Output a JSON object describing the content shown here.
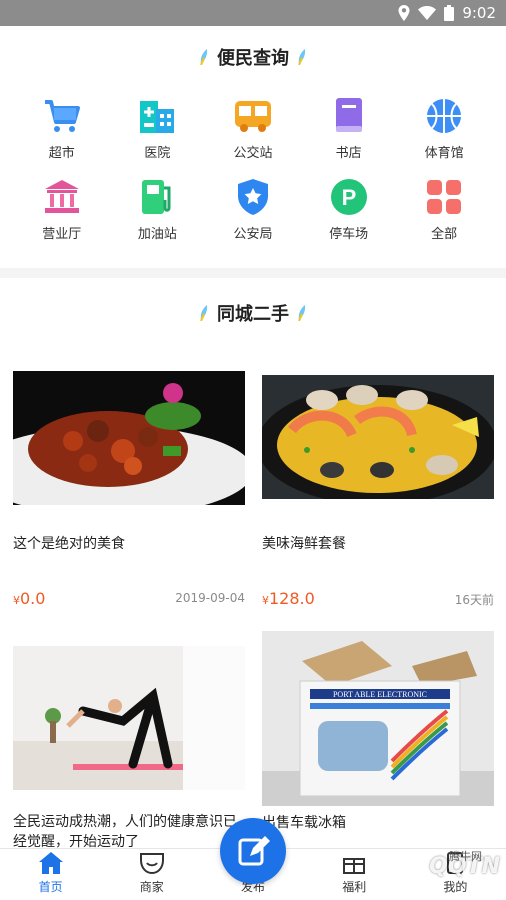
{
  "status_bar": {
    "time": "9:02"
  },
  "convenience": {
    "title": "便民查询",
    "items": [
      {
        "label": "超市",
        "icon": "cart-icon",
        "color": "#3a8ef0"
      },
      {
        "label": "医院",
        "icon": "hospital-icon",
        "color": "#1bc2d8"
      },
      {
        "label": "公交站",
        "icon": "bus-icon",
        "color": "#f5a623"
      },
      {
        "label": "书店",
        "icon": "book-icon",
        "color": "#8f6be8"
      },
      {
        "label": "体育馆",
        "icon": "basketball-icon",
        "color": "#3d8ef5"
      },
      {
        "label": "营业厅",
        "icon": "bank-icon",
        "color": "#f06aa3"
      },
      {
        "label": "加油站",
        "icon": "gas-station-icon",
        "color": "#2fcf7c"
      },
      {
        "label": "公安局",
        "icon": "police-badge-icon",
        "color": "#2e86f0"
      },
      {
        "label": "停车场",
        "icon": "parking-icon",
        "color": "#22c47a"
      },
      {
        "label": "全部",
        "icon": "grid-icon",
        "color": "#f5706a"
      }
    ]
  },
  "secondhand": {
    "title": "同城二手",
    "products": [
      {
        "title": "这个是绝对的美食",
        "currency": "¥",
        "price": "0.0",
        "date": "2019-09-04"
      },
      {
        "title": "美味海鲜套餐",
        "currency": "¥",
        "price": "128.0",
        "date": "16天前"
      },
      {
        "title": "全民运动成热潮，人们的健康意识已经觉醒，开始运动了",
        "currency": "",
        "price": "",
        "date": ""
      },
      {
        "title": "出售车载冰箱",
        "currency": "",
        "price": "",
        "date": "",
        "box_text": "PORT ABLE ELECTRONIC"
      }
    ]
  },
  "tabbar": {
    "items": [
      {
        "label": "首页",
        "icon": "home-icon"
      },
      {
        "label": "商家",
        "icon": "shop-icon"
      },
      {
        "label": "发布",
        "icon": "edit-icon"
      },
      {
        "label": "福利",
        "icon": "gift-icon"
      },
      {
        "label": "我的",
        "icon": "user-icon"
      }
    ]
  },
  "watermark": {
    "text": "QQTN",
    "sub": "腾牛网"
  },
  "colors": {
    "accent": "#1e72e8",
    "price": "#f05a24"
  }
}
